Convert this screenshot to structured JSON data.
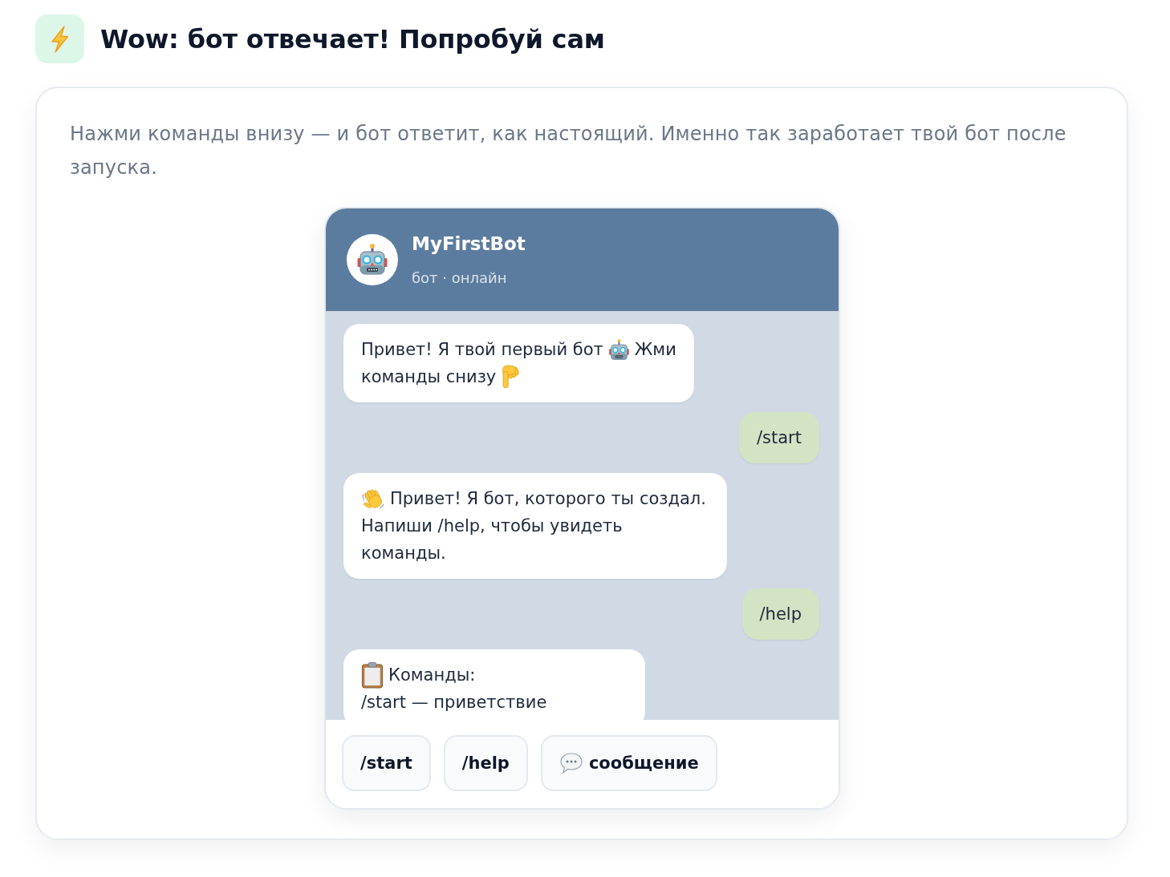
{
  "header": {
    "title": "Wow: бот отвечает! Попробуй сам"
  },
  "card": {
    "description": "Нажми команды внизу — и бот ответит, как настоящий. Именно так заработает твой бот после запуска.",
    "chat": {
      "bot_name": "MyFirstBot",
      "bot_status": "бот · онлайн",
      "messages": [
        {
          "kind": "bot",
          "lines": [
            [
              {
                "kind": "text",
                "text": "Привет! Я твой первый бот"
              },
              {
                "kind": "emoji"
              },
              {
                "kind": "text",
                "text": "Жми"
              }
            ],
            [
              {
                "kind": "text",
                "text": "команды снизу"
              },
              {
                "kind": "emoji"
              }
            ]
          ]
        },
        {
          "kind": "user",
          "text": "/start"
        },
        {
          "kind": "bot",
          "lines": [
            [
              {
                "kind": "emoji"
              },
              {
                "kind": "text",
                "text": "Привет! Я бот, которого ты создал."
              }
            ],
            [
              {
                "kind": "text",
                "text": "Напиши /help, чтобы увидеть команды."
              }
            ]
          ]
        },
        {
          "kind": "user",
          "text": "/help"
        },
        {
          "kind": "bot",
          "lines": [
            [
              {
                "kind": "emoji"
              },
              {
                "kind": "text",
                "text": "Команды:"
              }
            ],
            [
              {
                "kind": "text",
                "text": "/start — приветствие"
              }
            ]
          ]
        }
      ],
      "quick_replies": [
        {
          "kind": "command",
          "label": "/start"
        },
        {
          "kind": "command",
          "label": "/help"
        },
        {
          "kind": "message",
          "label": "сообщение"
        }
      ]
    }
  }
}
